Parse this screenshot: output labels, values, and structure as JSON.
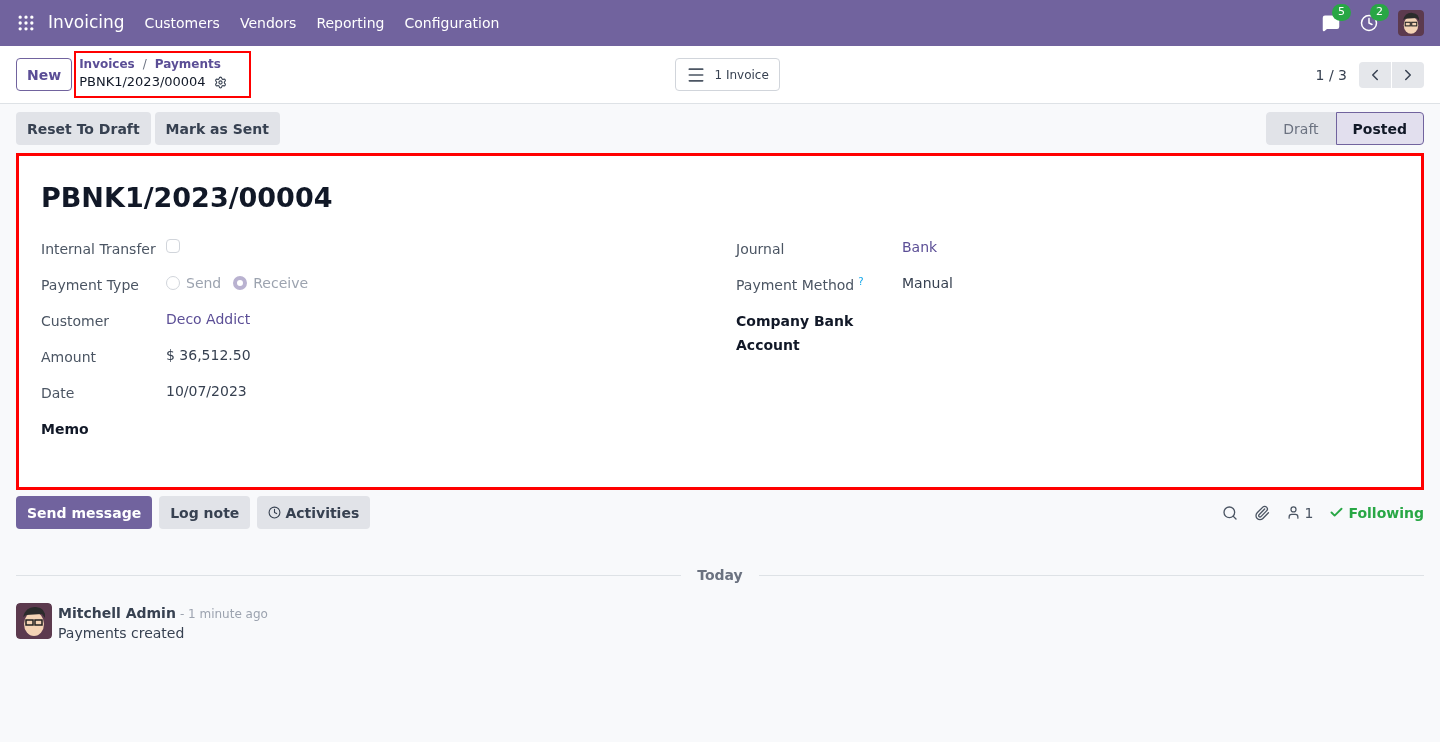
{
  "navbar": {
    "app": "Invoicing",
    "menu": [
      "Customers",
      "Vendors",
      "Reporting",
      "Configuration"
    ],
    "messages_count": "5",
    "activities_count": "2"
  },
  "control_panel": {
    "new_button": "New",
    "breadcrumbs": [
      "Invoices",
      "Payments"
    ],
    "breadcrumb_separator": "/",
    "record": "PBNK1/2023/00004",
    "smart_button": "1 Invoice",
    "pager": "1 / 3"
  },
  "actions": [
    "Reset To Draft",
    "Mark as Sent"
  ],
  "stages": [
    {
      "label": "Draft",
      "selected": false
    },
    {
      "label": "Posted",
      "selected": true
    }
  ],
  "form": {
    "title": "PBNK1/2023/00004",
    "left_fields": [
      {
        "label": "Internal Transfer",
        "kind": "checkbox",
        "checked": false
      },
      {
        "label": "Payment Type",
        "kind": "radio",
        "options": [
          {
            "label": "Send",
            "selected": false
          },
          {
            "label": "Receive",
            "selected": true
          }
        ]
      },
      {
        "label": "Customer",
        "kind": "link",
        "value": "Deco Addict"
      },
      {
        "label": "Amount",
        "kind": "text",
        "value": "$ 36,512.50"
      },
      {
        "label": "Date",
        "kind": "text",
        "value": "10/07/2023"
      },
      {
        "label": "Memo",
        "kind": "empty"
      }
    ],
    "right_fields": [
      {
        "label": "Journal",
        "kind": "link",
        "value": "Bank"
      },
      {
        "label": "Payment Method",
        "kind": "text",
        "value": "Manual",
        "help": "?"
      },
      {
        "label": "Company Bank Account",
        "kind": "empty"
      }
    ]
  },
  "chatter": {
    "buttons": [
      "Send message",
      "Log note",
      "Activities"
    ],
    "followers_count": "1",
    "follow": "Following",
    "divider": "Today",
    "messages": [
      {
        "author": "Mitchell Admin",
        "time": "- 1 minute ago",
        "body": "Payments created"
      }
    ]
  }
}
